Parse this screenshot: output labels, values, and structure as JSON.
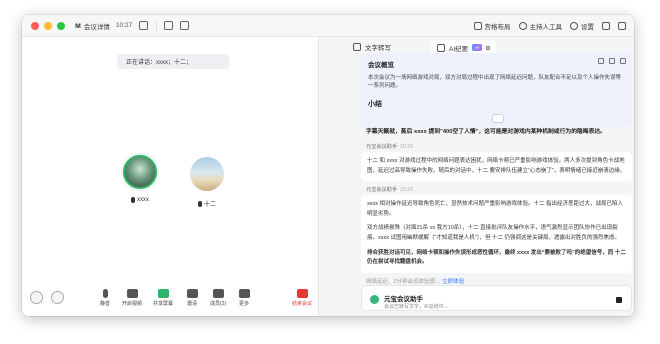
{
  "titlebar": {
    "app_logo": "",
    "meeting_title": "会议详情",
    "time": "10:27",
    "layout_label": "宫格布局",
    "host_tools_label": "主持人工具",
    "settings_label": "设置"
  },
  "left": {
    "speaking_label": "正在讲话：xxxx；十二；",
    "participants": [
      {
        "name": "xxxx"
      },
      {
        "name": "十二"
      }
    ],
    "toolbar": {
      "mute": "静音",
      "video": "开启视频",
      "share": "共享屏幕",
      "members": "邀请",
      "manage": "成员(2)",
      "more": "更多",
      "leave": "结束会议"
    }
  },
  "right": {
    "tab_transcript": "文字转写",
    "tab_ai": "AI纪要",
    "ai_badge": "AI",
    "summary": {
      "title": "会议概览",
      "body": "本次会议为一场网络游戏对局，双方对局过程中出现了网络延迟问题，队友配合不足以及个人操作失误等一系列问题。",
      "subtitle": "小结",
      "tail": "字幕天籁就，蒸后 xxxx 提到\"400空了人情\"，这可能是对游戏内某种机制或行为的隐晦表达。"
    },
    "messages": [
      {
        "sender": "元宝会议助手",
        "time": "10:26",
        "text": "十二 和 xxxx 对游戏过程中的网络问题表达困扰，网络卡顿已严重影响游戏体验。两人多次提到角色卡战地图，延迟过高导致操作失败。随后的对话中，十二 要安排队伍建立“心态崩了”，表明情绪已接近崩溃边缘。"
      },
      {
        "sender": "元宝会议助手",
        "time": "10:26",
        "p1": "xxxx 相对操作延迟导致角色死亡，显然技术问题严重影响游戏体验。十二 指出经济差距过大，战局已陷入明显劣势。",
        "p2": "双方战绩悬殊（对面21杀 vs 我方10杀），十二 直接批评队友操作水平，语气激烈显示团队协作已出现裂痕。xxxx 试图用幽默缓解（“才知道我是人机”），但 十二 仍强调这是关键局，透露出对胜负的强烈焦虑。",
        "p3": "排合获胜对话可见，网络卡顿和操作失误形成恶性循环，最终 xxxx 发出“要被败了吗”的绝望信号，而 十二 仍在尝试寻找翻盘机会。"
      }
    ],
    "footer_note": "网络延迟、2分钟会议体验感…",
    "footer_link": "立即体验",
    "input": {
      "title": "元宝会议助手",
      "subtitle": "会议已转写文字，AI总结中…"
    }
  },
  "colors": {
    "accent": "#3370ff",
    "end_red": "#e53935",
    "speaking_green": "#2fb36a"
  }
}
